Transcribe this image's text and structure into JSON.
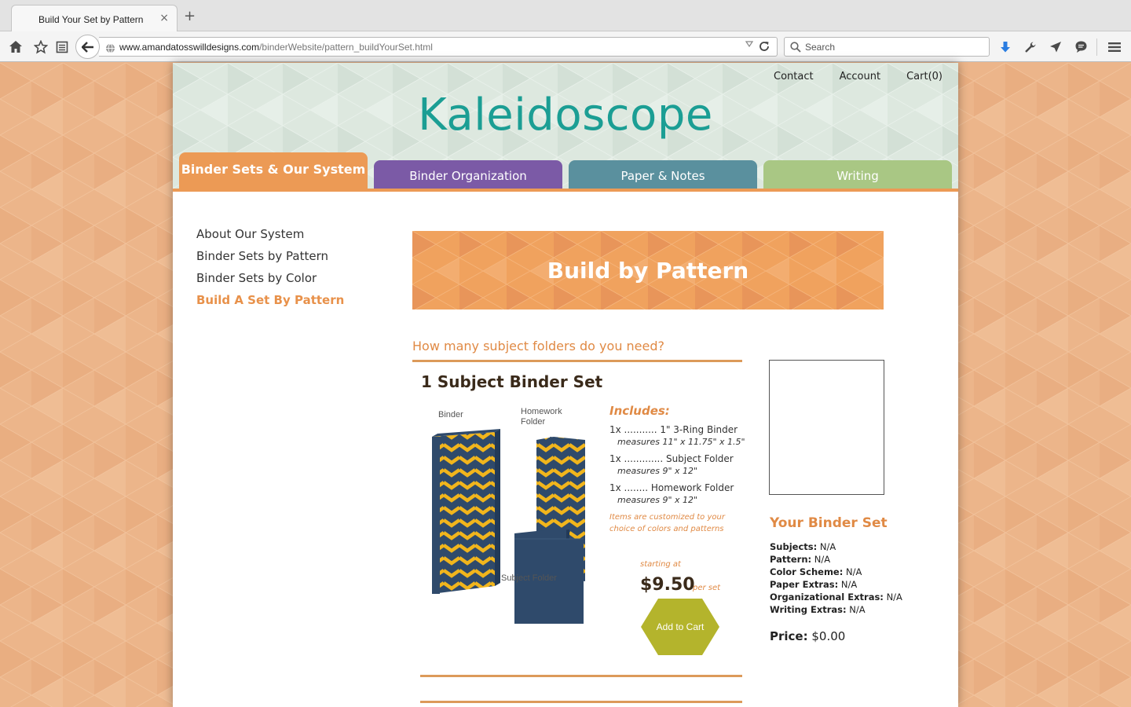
{
  "browser": {
    "tab_title": "Build Your Set by Pattern",
    "tab_close": "×",
    "new_tab": "+",
    "url_host": "www.amandatosswilldesigns.com",
    "url_path": "/binderWebsite/pattern_buildYourSet.html",
    "search_placeholder": "Search"
  },
  "header": {
    "links": [
      "Contact",
      "Account",
      "Cart(0)"
    ],
    "logo": "Kaleidoscope"
  },
  "main_tabs": [
    {
      "label": "Binder Sets & Our System",
      "active": true,
      "color": "#ec9a55"
    },
    {
      "label": "Binder Organization",
      "active": false,
      "color": "#7b5aa6"
    },
    {
      "label": "Paper & Notes",
      "active": false,
      "color": "#5a909e"
    },
    {
      "label": "Writing",
      "active": false,
      "color": "#a9c784"
    }
  ],
  "sidebar": {
    "items": [
      {
        "label": "About Our System",
        "active": false
      },
      {
        "label": "Binder Sets by Pattern",
        "active": false
      },
      {
        "label": "Binder Sets by Color",
        "active": false
      },
      {
        "label": "Build A Set By Pattern",
        "active": true
      }
    ]
  },
  "banner": {
    "title": "Build by Pattern"
  },
  "question": "How many subject folders do you need?",
  "product": {
    "title": "1 Subject Binder Set",
    "illustration_labels": {
      "binder": "Binder",
      "homework_folder": "Homework Folder",
      "subject_folder": "Subject Folder"
    },
    "includes_title": "Includes:",
    "includes": [
      {
        "item": "1x ........... 1\" 3-Ring Binder",
        "measure": "measures 11\" x 11.75\" x 1.5\""
      },
      {
        "item": "1x ............. Subject Folder",
        "measure": "measures 9\" x 12\""
      },
      {
        "item": "1x ........ Homework Folder",
        "measure": "measures 9\" x 12\""
      }
    ],
    "note": "Items are customized to your choice of colors and patterns",
    "starting_at": "starting at",
    "price": "$9.50",
    "per_set": "per set",
    "add_to_cart": "Add to Cart"
  },
  "your_set": {
    "title": "Your Binder Set",
    "fields": [
      {
        "label": "Subjects:",
        "value": "N/A"
      },
      {
        "label": "Pattern:",
        "value": "N/A"
      },
      {
        "label": "Color Scheme:",
        "value": "N/A"
      },
      {
        "label": "Paper Extras:",
        "value": "N/A"
      },
      {
        "label": "Organizational Extras:",
        "value": "N/A"
      },
      {
        "label": "Writing Extras:",
        "value": "N/A"
      }
    ],
    "price_label": "Price:",
    "price_value": "$0.00"
  },
  "colors": {
    "accent_orange": "#ec9a55",
    "logo_teal": "#1b9e94",
    "navy": "#2f4a6b",
    "chevron_yellow": "#f1b51c",
    "cart_olive": "#b4b42c"
  }
}
